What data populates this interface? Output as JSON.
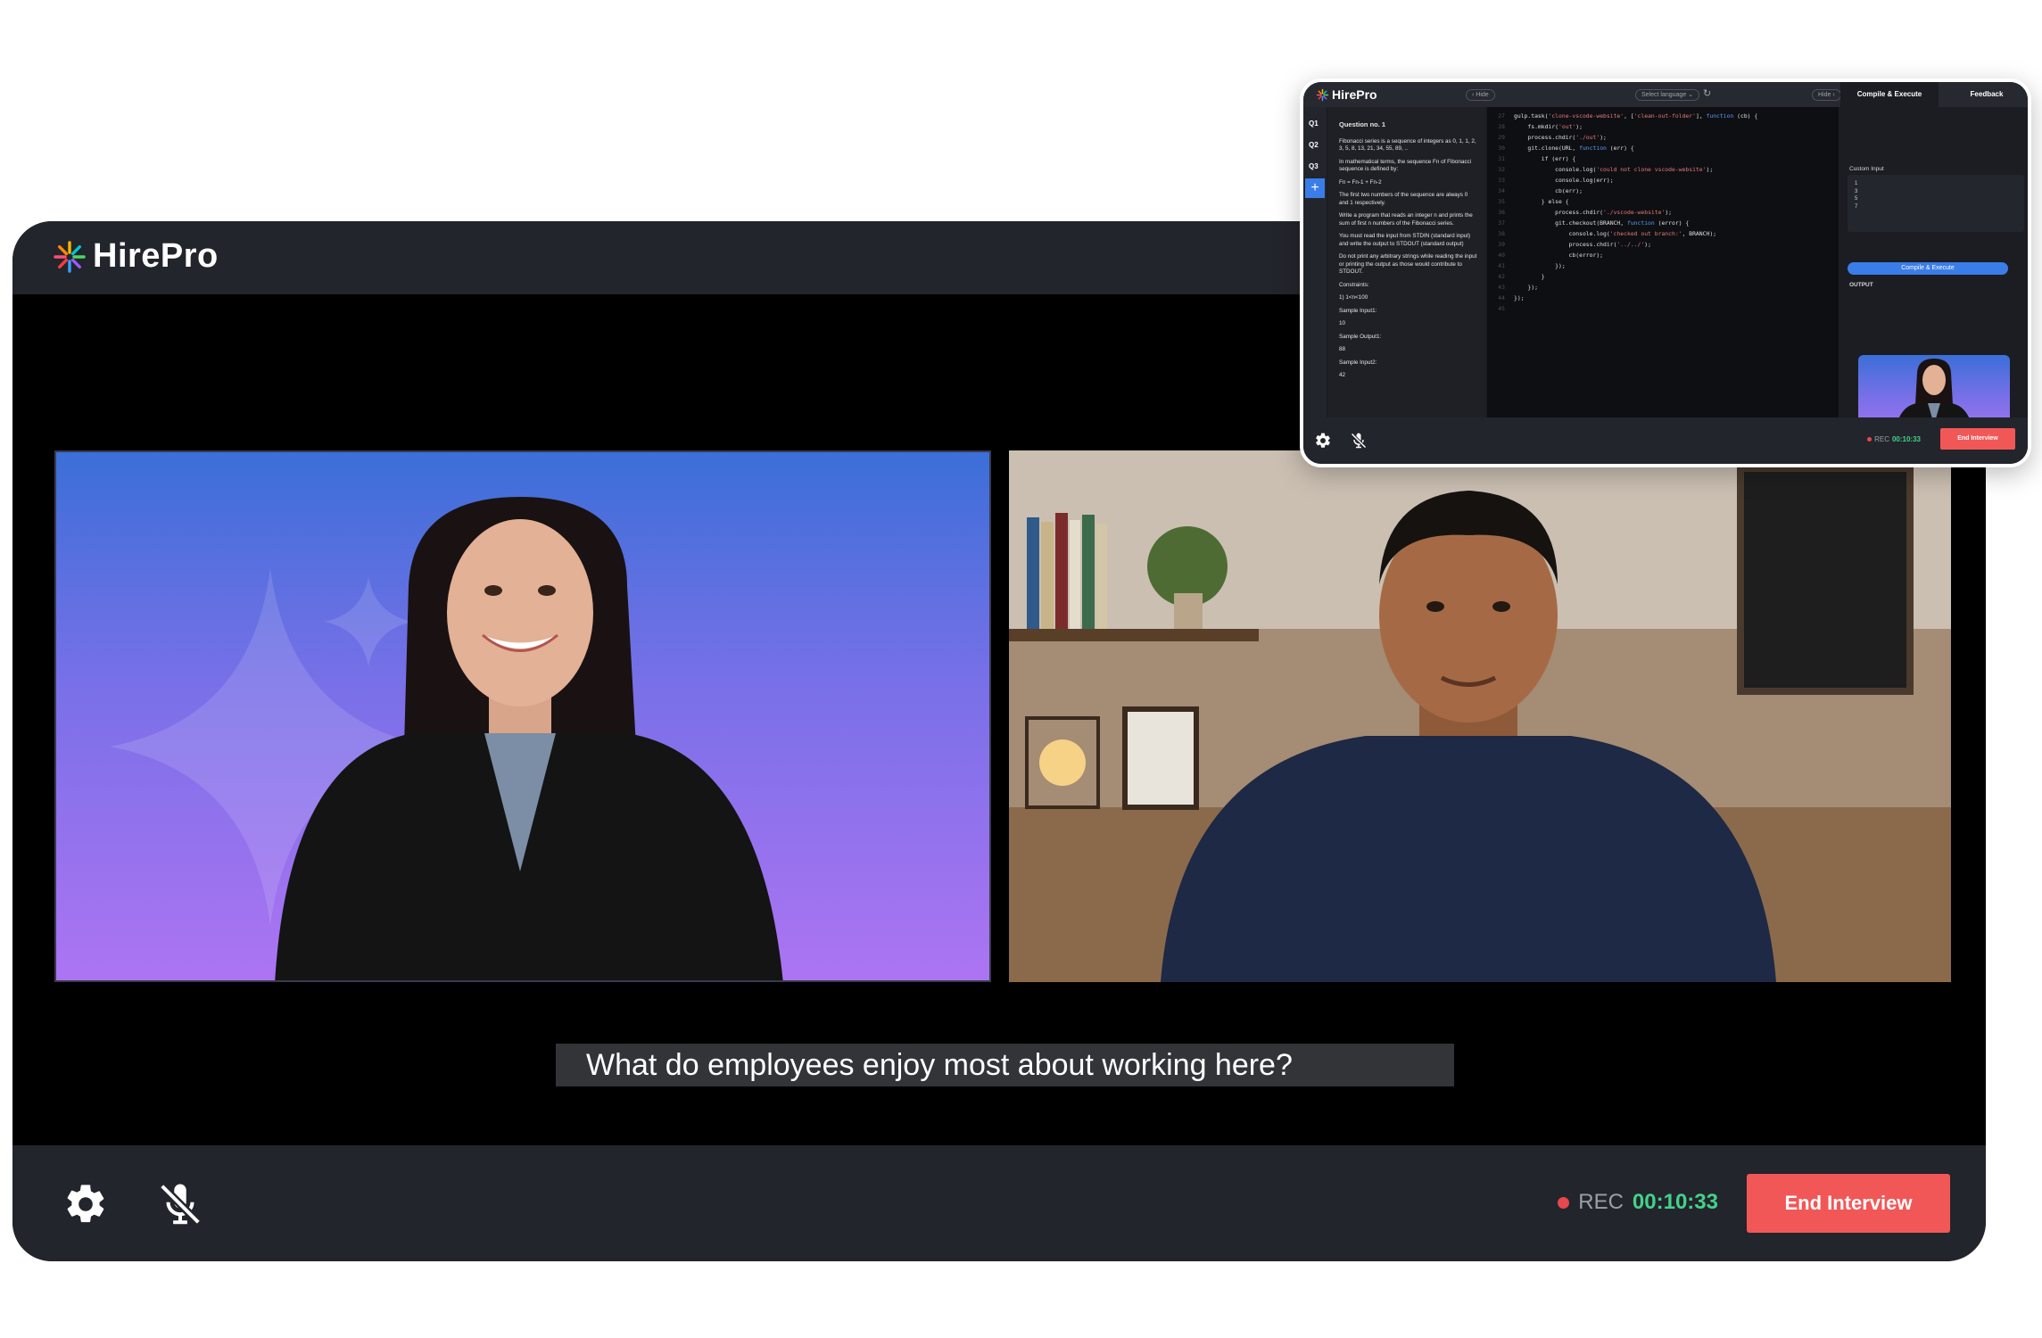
{
  "main": {
    "brand": "HirePro",
    "subtitle": "What do employees enjoy most about working here?",
    "footer": {
      "rec_label": "REC",
      "timer": "00:10:33",
      "end_label": "End Interview"
    }
  },
  "inset": {
    "brand": "HirePro",
    "hide_left": "Hide",
    "select_language": "Select language",
    "hide_right": "Hide",
    "tabs": [
      "Compile & Execute",
      "Feedback"
    ],
    "questions": [
      "Q1",
      "Q2",
      "Q3"
    ],
    "add_label": "+",
    "question": {
      "title": "Question no. 1",
      "paragraphs": [
        "Fibonacci series is a sequence of integers as 0, 1, 1, 2, 3, 5, 8, 13, 21, 34, 55, 89, ..",
        "In mathematical terms, the sequence Fn of Fibonacci sequence is defined by:",
        "Fn = Fn-1 + Fn-2",
        "The first two numbers of the sequence are always 0 and 1 respectively.",
        "Write a program that reads an integer n and prints the sum of first n numbers of the Fibonacci series.",
        "You must read the input from STDIN (standard input) and write the output to STDOUT (standard output)",
        "Do not print any arbitrary strings while reading the input or printing the output as those would contribute to STDOUT.",
        "Constraints:",
        "1) 1<n<100",
        "Sample Input1:",
        "10",
        "Sample Output1:",
        "88",
        "Sample Input2:",
        "42"
      ]
    },
    "code": [
      {
        "n": "27",
        "t": "gulp.task('clone-vscode-website', ['clean-out-folder'], function (cb) {"
      },
      {
        "n": "28",
        "t": "    fs.mkdir('out');"
      },
      {
        "n": "29",
        "t": "    process.chdir('./out');"
      },
      {
        "n": "30",
        "t": "    git.clone(URL, function (err) {"
      },
      {
        "n": "31",
        "t": "        if (err) {"
      },
      {
        "n": "32",
        "t": "            console.log('could not clone vscode-website');"
      },
      {
        "n": "33",
        "t": "            console.log(err);"
      },
      {
        "n": "34",
        "t": "            cb(err);"
      },
      {
        "n": "35",
        "t": "        } else {"
      },
      {
        "n": "36",
        "t": "            process.chdir('./vscode-website');"
      },
      {
        "n": "37",
        "t": "            git.checkout(BRANCH, function (error) {"
      },
      {
        "n": "38",
        "t": "                console.log('checked out branch:', BRANCH);"
      },
      {
        "n": "39",
        "t": "                process.chdir('../../');"
      },
      {
        "n": "40",
        "t": "                cb(error);"
      },
      {
        "n": "41",
        "t": "            });"
      },
      {
        "n": "42",
        "t": "        }"
      },
      {
        "n": "43",
        "t": "    });"
      },
      {
        "n": "44",
        "t": "});"
      },
      {
        "n": "45",
        "t": ""
      }
    ],
    "custom_input_label": "Custom Input",
    "custom_input_values": [
      "1",
      "3",
      "5",
      "7"
    ],
    "compile_button": "Compile & Execute",
    "output_label": "OUTPUT",
    "footer": {
      "rec_label": "REC",
      "timer": "00:10:33",
      "end_label": "End Interview"
    }
  },
  "colors": {
    "accent_red": "#f25757",
    "timer_green": "#44d18a",
    "accent_blue": "#3b7de8",
    "panel_dark": "#22252b"
  },
  "icons": {
    "settings": "gear-icon",
    "mic": "mic-off-icon",
    "brand": "asterisk-star-icon"
  }
}
